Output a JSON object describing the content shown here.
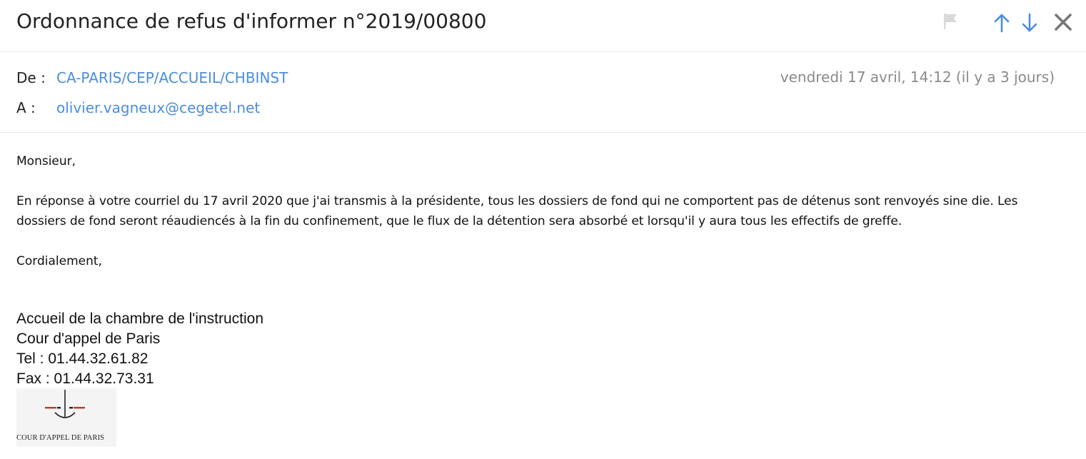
{
  "email": {
    "subject": "Ordonnance de refus d'informer n°2019/00800",
    "from_label": "De :",
    "from_value": "CA-PARIS/CEP/ACCUEIL/CHBINST",
    "to_label": "A :",
    "to_value": "olivier.vagneux@cegetel.net",
    "date": "vendredi 17 avril, 14:12 (il y a 3 jours)"
  },
  "toolbar": {
    "icons": [
      "flag-icon",
      "arrow-up-icon",
      "arrow-down-icon",
      "close-icon"
    ],
    "flag_color": "#d9d9d9",
    "arrow_color": "#4a8de0",
    "close_color": "#777777"
  },
  "body": {
    "greeting": "Monsieur,",
    "paragraph": "En réponse à votre courriel du 17 avril 2020 que j'ai transmis à la présidente, tous les dossiers de fond qui ne comportent pas de détenus sont renvoyés sine die. Les dossiers de fond seront réaudiencés à la fin du confinement, que le flux de la détention sera absorbé et lorsqu'il y aura tous les effectifs de greffe.",
    "closing": "Cordialement,"
  },
  "signature": {
    "line1": "Accueil de la chambre de l'instruction",
    "line2": "Cour d'appel de Paris",
    "line3": "Tel : 01.44.32.61.82",
    "line4": "Fax : 01.44.32.73.31"
  },
  "logo": {
    "text": "COUR D'APPEL DE PARIS",
    "accent_color": "#c0392b"
  }
}
